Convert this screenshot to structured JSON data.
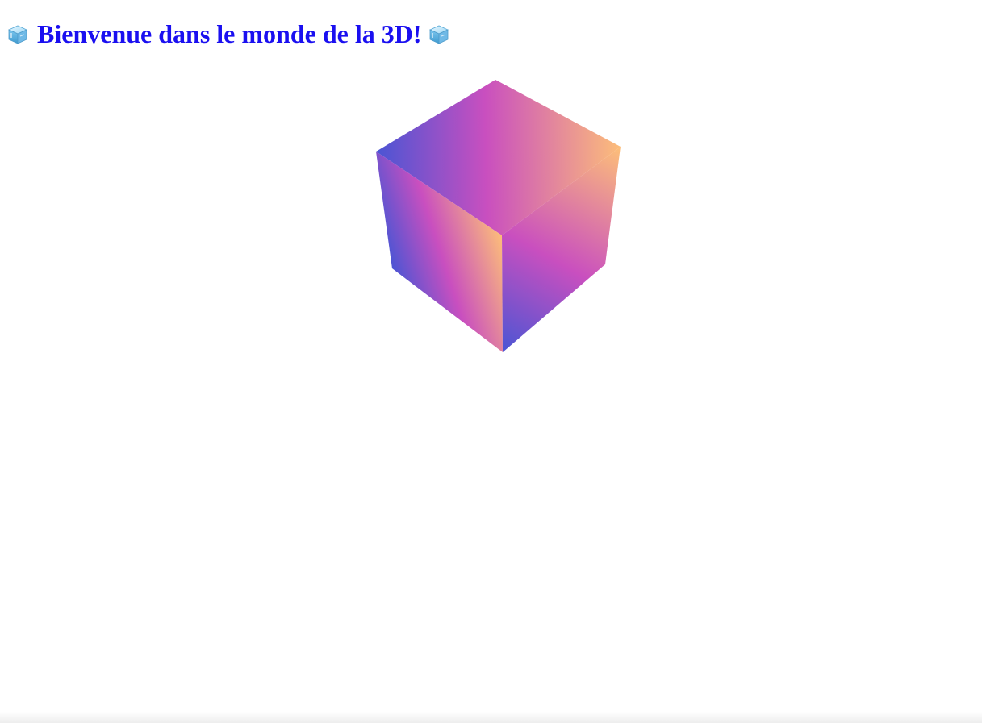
{
  "page": {
    "heading_text": "Bienvenue dans le monde de la 3D!",
    "heading_color": "#1a0ff0",
    "heading_icon_left": "ice-cube-icon",
    "heading_icon_right": "ice-cube-icon"
  },
  "cube": {
    "gradient_colors": [
      "#4a55d4",
      "#c94fbf",
      "#fcbd7a"
    ]
  }
}
